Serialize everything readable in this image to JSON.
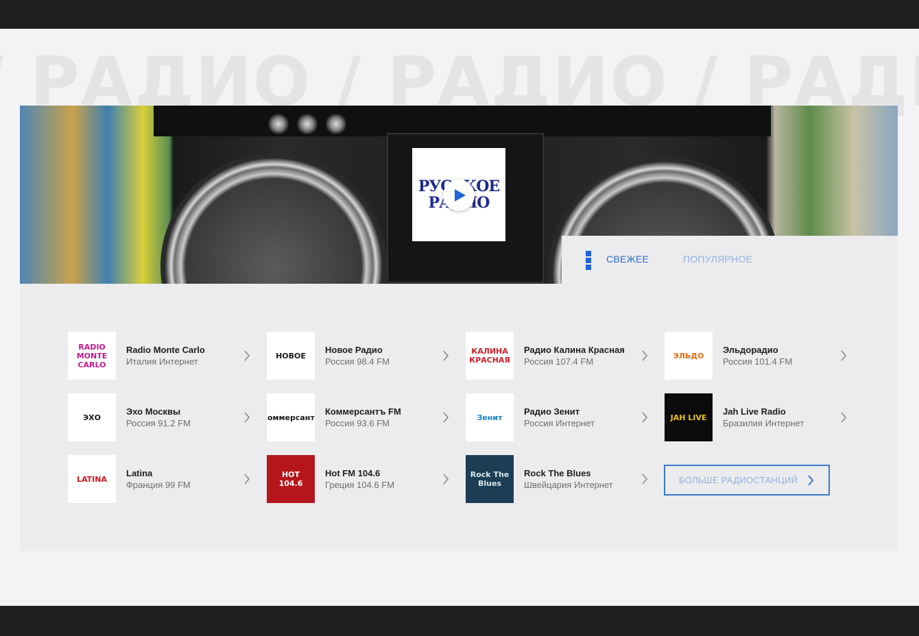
{
  "watermark": {
    "text": "/ РАДИО / РАДИО / РАДИО"
  },
  "featured": {
    "logo_line1": "РУССКОЕ",
    "logo_line2": "РАДИО",
    "play_icon": "play-icon"
  },
  "tabs": [
    {
      "label": "СВЕЖЕЕ",
      "active": true
    },
    {
      "label": "ПОПУЛЯРНОЕ",
      "active": false
    }
  ],
  "stations": [
    {
      "name": "Radio Monte Carlo",
      "meta": "Италия Интернет",
      "logo_text": "RADIO MONTE CARLO",
      "logo_bg": "#ffffff",
      "logo_color": "#c2188f"
    },
    {
      "name": "Новое Радио",
      "meta": "Россия 98.4 FM",
      "logo_text": "НОВОЕ",
      "logo_bg": "#ffffff",
      "logo_color": "#1a1a1a"
    },
    {
      "name": "Радио Калина Красная",
      "meta": "Россия 107.4 FM",
      "logo_text": "КАЛИНА КРАСНАЯ",
      "logo_bg": "#ffffff",
      "logo_color": "#d01f2a"
    },
    {
      "name": "Эльдорадио",
      "meta": "Россия 101.4 FM",
      "logo_text": "ЭЛЬДО",
      "logo_bg": "#ffffff",
      "logo_color": "#e86a10"
    },
    {
      "name": "Эхо Москвы",
      "meta": "Россия 91.2 FM",
      "logo_text": "ЭХО",
      "logo_bg": "#ffffff",
      "logo_color": "#1a1a1a"
    },
    {
      "name": "Коммерсантъ FM",
      "meta": "Россия 93.6 FM",
      "logo_text": "Коммерсантъ",
      "logo_bg": "#ffffff",
      "logo_color": "#1a1a1a"
    },
    {
      "name": "Радио Зенит",
      "meta": "Россия Интернет",
      "logo_text": "Зенит",
      "logo_bg": "#ffffff",
      "logo_color": "#1b7fc4"
    },
    {
      "name": "Jah Live Radio",
      "meta": "Бразилия Интернет",
      "logo_text": "JAH LIVE",
      "logo_bg": "#0b0b0b",
      "logo_color": "#e8c21a"
    },
    {
      "name": "Latina",
      "meta": "Франция 99 FM",
      "logo_text": "LATINA",
      "logo_bg": "#ffffff",
      "logo_color": "#d3141c"
    },
    {
      "name": "Hot FM 104.6",
      "meta": "Греция 104.6 FM",
      "logo_text": "HOT 104.6",
      "logo_bg": "#b5161b",
      "logo_color": "#ffffff"
    },
    {
      "name": "Rock The Blues",
      "meta": "Швейцария Интернет",
      "logo_text": "Rock The Blues",
      "logo_bg": "#1d3d55",
      "logo_color": "#d8e6f0"
    }
  ],
  "more_button": {
    "label": "БОЛЬШЕ РАДИОСТАНЦИЙ"
  },
  "colors": {
    "accent": "#1f64d8",
    "accent_light": "#8fb0e2"
  }
}
